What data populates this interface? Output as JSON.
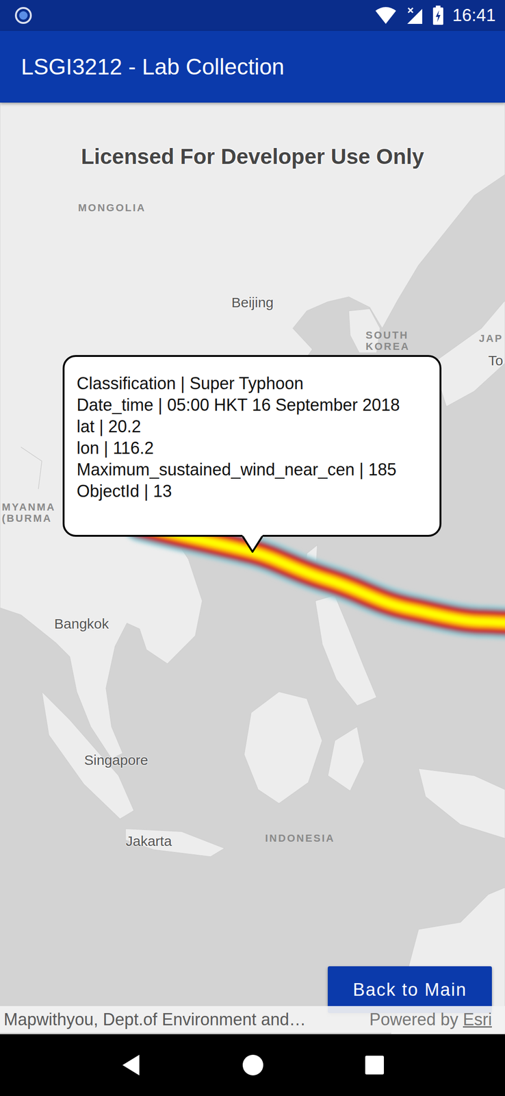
{
  "status_bar": {
    "time": "16:41"
  },
  "app_bar": {
    "title": "LSGI3212 - Lab Collection"
  },
  "map": {
    "watermark": "Licensed For Developer Use Only",
    "labels": [
      {
        "text": "MONGOLIA",
        "kind": "country"
      },
      {
        "text": "Beijing",
        "kind": "city"
      },
      {
        "text": "SOUTH KOREA",
        "kind": "country"
      },
      {
        "text": "JAP",
        "kind": "country"
      },
      {
        "text": "To",
        "kind": "city"
      },
      {
        "text": "MYANMA (BURMA",
        "kind": "country"
      },
      {
        "text": "Bangkok",
        "kind": "city"
      },
      {
        "text": "Singapore",
        "kind": "city"
      },
      {
        "text": "Jakarta",
        "kind": "city"
      },
      {
        "text": "INDONESIA",
        "kind": "country"
      }
    ]
  },
  "callout": {
    "separator": "|",
    "rows": [
      {
        "key": "Classification",
        "value": "Super Typhoon"
      },
      {
        "key": "Date_time",
        "value": "05:00 HKT 16 September 2018"
      },
      {
        "key": "lat",
        "value": "20.2"
      },
      {
        "key": "lon",
        "value": "116.2"
      },
      {
        "key": "Maximum_sustained_wind_near_cen",
        "value": "185"
      },
      {
        "key": "ObjectId",
        "value": "13"
      }
    ]
  },
  "buttons": [
    {
      "label": "Back to Main"
    }
  ],
  "attribution": {
    "credits": "Mapwithyou, Dept.of Environment and…",
    "powered_by": "Powered by",
    "link": "Esri"
  }
}
